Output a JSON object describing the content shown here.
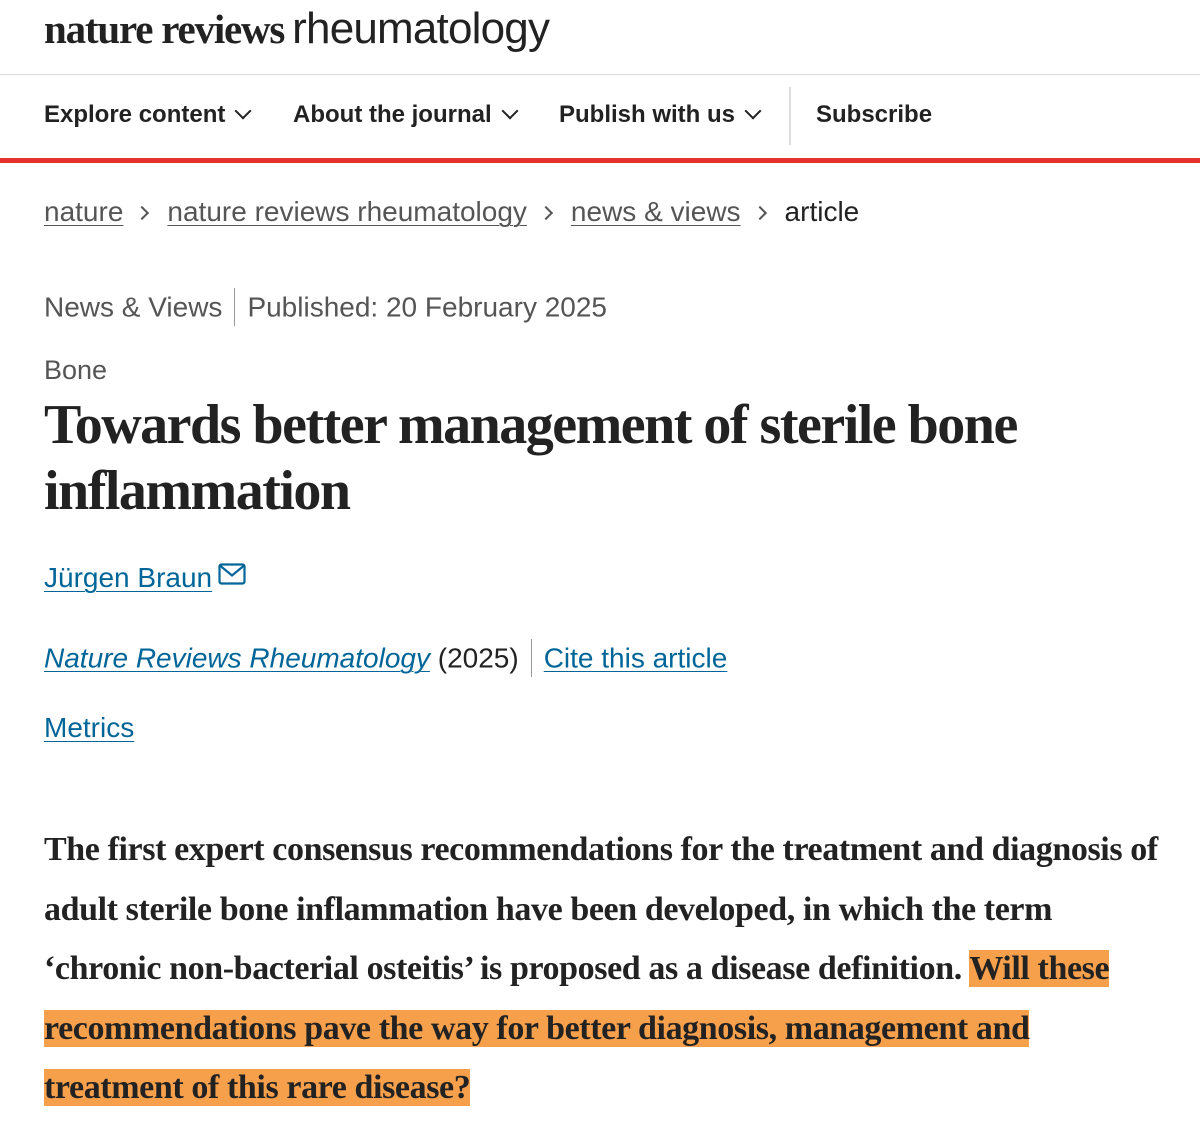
{
  "header": {
    "brand_main": "nature reviews",
    "brand_sub": "rheumatology"
  },
  "nav": {
    "explore": "Explore content",
    "about": "About the journal",
    "publish": "Publish with us",
    "subscribe": "Subscribe"
  },
  "breadcrumb": [
    "nature",
    "nature reviews rheumatology",
    "news & views",
    "article"
  ],
  "meta": {
    "type": "News & Views",
    "published": "Published: 20 February 2025"
  },
  "subject": "Bone",
  "title": "Towards better management of sterile bone inflammation",
  "author": "Jürgen Braun",
  "citation": {
    "journal": "Nature Reviews Rheumatology",
    "year": "(2025)",
    "cite": "Cite this article"
  },
  "metrics": "Metrics",
  "standfirst": {
    "text": "The first expert consensus recommendations for the treatment and diagnosis of adult sterile bone inflammation have been developed, in which the term ‘chronic non-bacterial osteitis’ is proposed as a disease definition.",
    "highlighted": "Will these recommendations pave the way for better diagnosis, management and treatment of this rare disease?"
  },
  "colors": {
    "accent_red": "#e5322d",
    "link_blue": "#006699",
    "highlight": "#f7a04c"
  }
}
